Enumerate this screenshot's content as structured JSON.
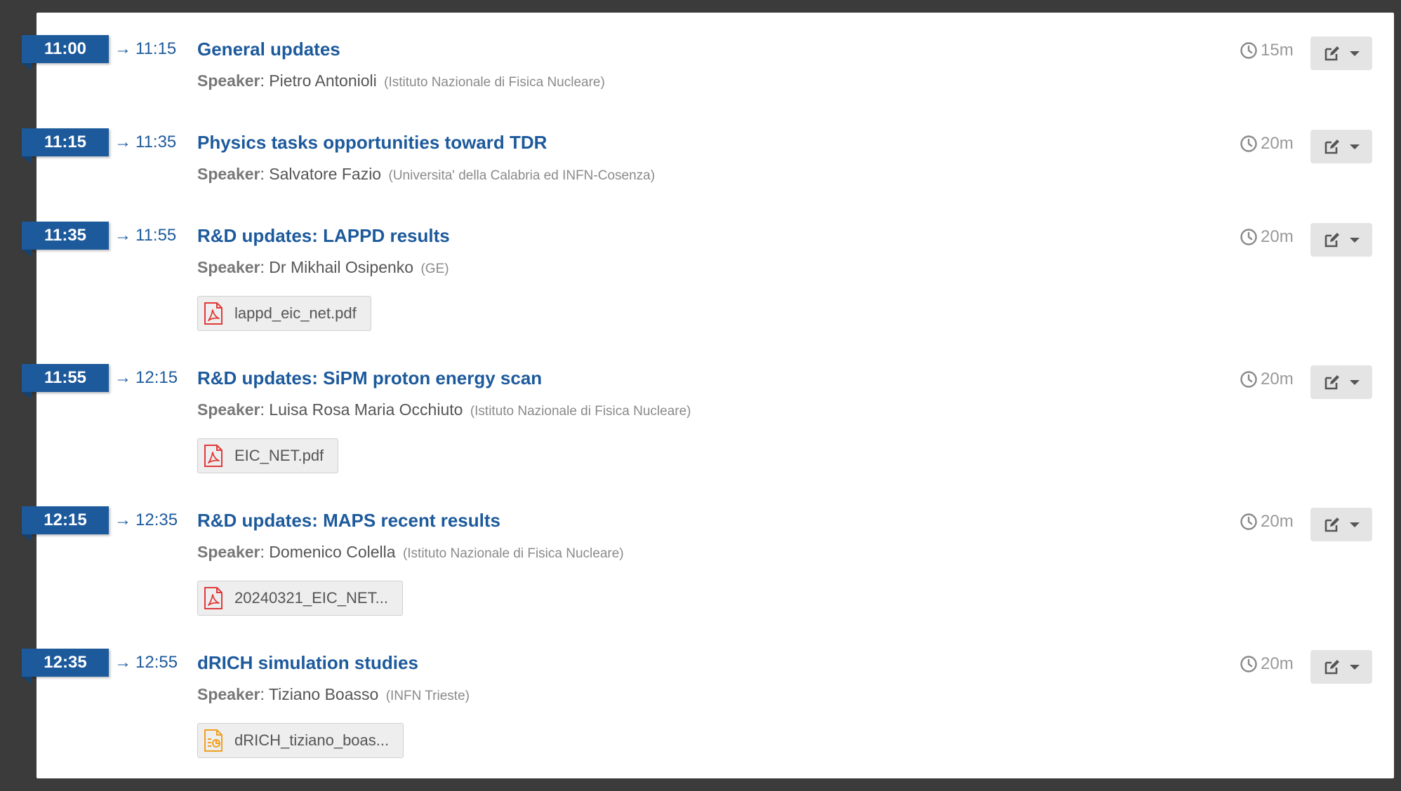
{
  "colors": {
    "accent": "#1d5a9c",
    "pdf_icon": "#e03a3a",
    "ppt_icon": "#f0a020"
  },
  "entries": [
    {
      "start": "11:00",
      "end": "11:15",
      "arrow": "→",
      "title": "General updates",
      "speaker_label": "Speaker",
      "speaker_name": "Pietro Antonioli",
      "affiliation": "(Istituto Nazionale di Fisica Nucleare)",
      "duration": "15m",
      "attachment": null
    },
    {
      "start": "11:15",
      "end": "11:35",
      "arrow": "→",
      "title": "Physics tasks opportunities toward TDR",
      "speaker_label": "Speaker",
      "speaker_name": "Salvatore Fazio",
      "affiliation": "(Universita' della Calabria ed INFN-Cosenza)",
      "duration": "20m",
      "attachment": null
    },
    {
      "start": "11:35",
      "end": "11:55",
      "arrow": "→",
      "title": "R&D updates: LAPPD results",
      "speaker_label": "Speaker",
      "speaker_name": "Dr Mikhail Osipenko",
      "affiliation": "(GE)",
      "duration": "20m",
      "attachment": {
        "name": "lappd_eic_net.pdf",
        "icon": "pdf-file-icon"
      }
    },
    {
      "start": "11:55",
      "end": "12:15",
      "arrow": "→",
      "title": "R&D updates: SiPM proton energy scan",
      "speaker_label": "Speaker",
      "speaker_name": "Luisa Rosa Maria Occhiuto",
      "affiliation": "(Istituto Nazionale di Fisica Nucleare)",
      "duration": "20m",
      "attachment": {
        "name": "EIC_NET.pdf",
        "icon": "pdf-file-icon"
      }
    },
    {
      "start": "12:15",
      "end": "12:35",
      "arrow": "→",
      "title": "R&D updates: MAPS recent results",
      "speaker_label": "Speaker",
      "speaker_name": "Domenico Colella",
      "affiliation": "(Istituto Nazionale di Fisica Nucleare)",
      "duration": "20m",
      "attachment": {
        "name": "20240321_EIC_NET...",
        "icon": "pdf-file-icon"
      }
    },
    {
      "start": "12:35",
      "end": "12:55",
      "arrow": "→",
      "title": "dRICH simulation studies",
      "speaker_label": "Speaker",
      "speaker_name": "Tiziano Boasso",
      "affiliation": "(INFN Trieste)",
      "duration": "20m",
      "attachment": {
        "name": "dRICH_tiziano_boas...",
        "icon": "presentation-file-icon"
      }
    }
  ]
}
